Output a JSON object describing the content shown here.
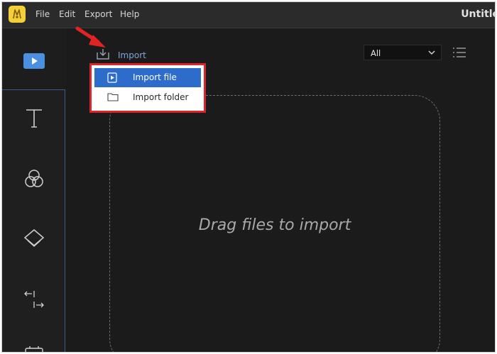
{
  "menubar": {
    "items": [
      "File",
      "Edit",
      "Export",
      "Help"
    ],
    "title": "Untitle"
  },
  "sidebar": {
    "buttons": [
      "media-icon",
      "text-icon",
      "filters-icon",
      "overlays-icon",
      "transitions-icon",
      "elements-icon"
    ],
    "active": "media-icon",
    "accent": "#4a8fe0"
  },
  "media": {
    "import_label": "Import",
    "filter": {
      "selected": "All"
    },
    "drop_text": "Drag files to import"
  },
  "dropdown": {
    "items": [
      {
        "label": "Import file",
        "icon": "video-file-icon",
        "selected": true
      },
      {
        "label": "Import folder",
        "icon": "folder-icon",
        "selected": false
      }
    ],
    "highlight_color": "#d8242b",
    "selected_color": "#2d6ccb"
  },
  "annotation": {
    "arrow_color": "#e02424"
  }
}
